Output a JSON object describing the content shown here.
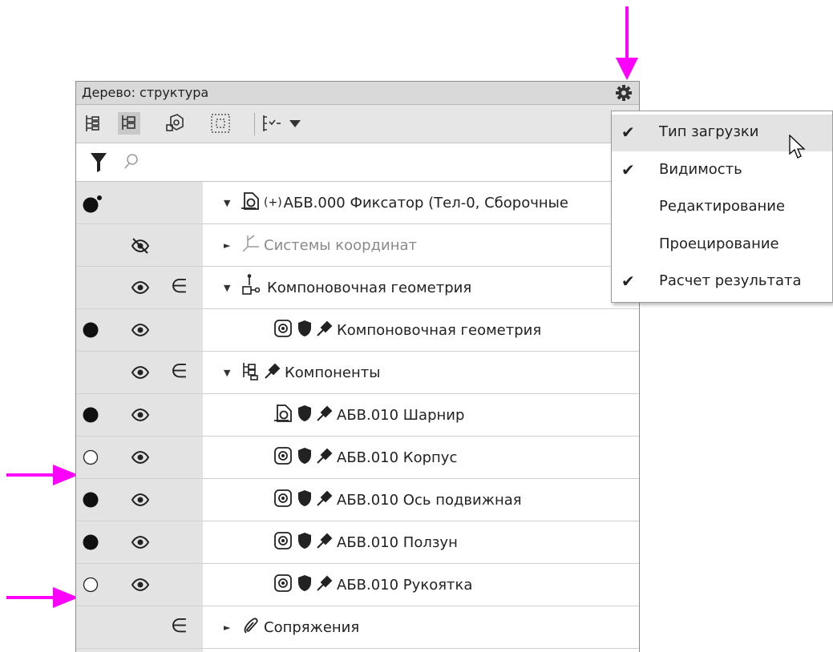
{
  "panel": {
    "title": "Дерево: структура",
    "search": {
      "placeholder": ""
    },
    "rows": [
      {
        "load": "root",
        "vis": "",
        "edit": false,
        "indent": 0,
        "expand": "down",
        "icon": "assembly-icon",
        "prefix": "(+)",
        "label": "АБВ.000 Фиксатор (Тел-0, Сборочные",
        "gray": false
      },
      {
        "load": "",
        "vis": "hidden",
        "edit": false,
        "indent": 0,
        "expand": "right",
        "icon": "coordinate-system-icon",
        "prefix": "",
        "label": "Системы координат",
        "gray": true
      },
      {
        "load": "",
        "vis": "visible",
        "edit": true,
        "indent": 0,
        "expand": "down",
        "icon": "layout-geometry-icon",
        "prefix": "",
        "label": "Компоновочная геометрия",
        "gray": false
      },
      {
        "load": "full",
        "vis": "visible",
        "edit": false,
        "indent": 1,
        "expand": "",
        "icon": "part-icon",
        "prefix": "",
        "label": "Компоновочная геометрия",
        "gray": false
      },
      {
        "load": "",
        "vis": "visible",
        "edit": true,
        "indent": 0,
        "expand": "down",
        "icon": "components-icon",
        "prefix": "",
        "label": "Компоненты",
        "gray": false
      },
      {
        "load": "full",
        "vis": "visible",
        "edit": false,
        "indent": 1,
        "expand": "",
        "icon": "subassembly-icon",
        "prefix": "",
        "label": "АБВ.010 Шарнир",
        "gray": false
      },
      {
        "load": "empty",
        "vis": "visible",
        "edit": false,
        "indent": 1,
        "expand": "",
        "icon": "part-icon",
        "prefix": "",
        "label": "АБВ.010 Корпус",
        "gray": false
      },
      {
        "load": "full",
        "vis": "visible",
        "edit": false,
        "indent": 1,
        "expand": "",
        "icon": "part-icon",
        "prefix": "",
        "label": "АБВ.010 Ось подвижная",
        "gray": false
      },
      {
        "load": "full",
        "vis": "visible",
        "edit": false,
        "indent": 1,
        "expand": "",
        "icon": "part-icon",
        "prefix": "",
        "label": "АБВ.010 Ползун",
        "gray": false
      },
      {
        "load": "empty",
        "vis": "visible",
        "edit": false,
        "indent": 1,
        "expand": "",
        "icon": "part-icon",
        "prefix": "",
        "label": "АБВ.010 Рукоятка",
        "gray": false
      },
      {
        "load": "",
        "vis": "",
        "edit": true,
        "indent": 0,
        "expand": "right",
        "icon": "mates-icon",
        "prefix": "",
        "label": "Сопряжения",
        "gray": false
      }
    ]
  },
  "menu": {
    "items": [
      {
        "label": "Тип загрузки",
        "checked": true,
        "highlighted": true
      },
      {
        "label": "Видимость",
        "checked": true,
        "highlighted": false
      },
      {
        "label": "Редактирование",
        "checked": false,
        "highlighted": false
      },
      {
        "label": "Проецирование",
        "checked": false,
        "highlighted": false
      },
      {
        "label": "Расчет результата",
        "checked": true,
        "highlighted": false
      }
    ]
  },
  "colors": {
    "arrow": "#ff00ff",
    "panel_column_bg": "#e3e3e3",
    "titlebar_bg": "#d9d9d9"
  },
  "edit_symbol": "∈",
  "check_symbol": "✔"
}
